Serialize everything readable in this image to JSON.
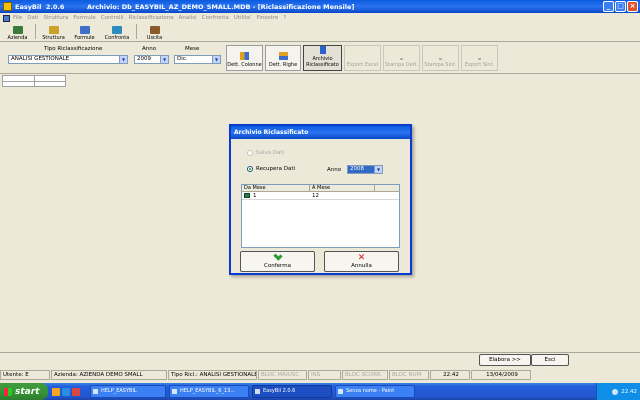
{
  "window": {
    "title": "EasyBil  2.0.6          Archivio: Db_EASYBIL_AZ_DEMO_SMALL.MDB - [Riclassificazione Mensile]"
  },
  "menu": [
    "File",
    "Dati",
    "Struttura",
    "Formule",
    "Controlli",
    "Riclassificazione",
    "Analisi",
    "Confronta",
    "Utilita'",
    "Finestre",
    "?"
  ],
  "toolbar": [
    {
      "label": "Azienda",
      "icon": "building-icon",
      "color": "#3a7a3a"
    },
    {
      "label": "Struttura",
      "icon": "structure-icon",
      "color": "#c9a227"
    },
    {
      "label": "Formule",
      "icon": "formula-icon",
      "color": "#3b6fc9"
    },
    {
      "label": "Confronta",
      "icon": "compare-icon",
      "color": "#2e8bc0"
    },
    {
      "label": "Uscita",
      "icon": "exit-icon",
      "color": "#8a5a2a"
    }
  ],
  "params": {
    "tipo_label": "Tipo Riclassificazione",
    "tipo_value": "ANALISI GESTIONALE",
    "anno_label": "Anno",
    "anno_value": "2009",
    "mese_label": "Mese",
    "mese_value": "Dic."
  },
  "action_buttons": {
    "dett_colonne": "Dett. Colonne",
    "dett_righe": "Dett. Righe",
    "archivio": "Archivio\nRiclassificato",
    "export_excel": "Export Excel",
    "stampa_dett": "Stampa Dett.",
    "stampa_sint": "Stampa Sint.",
    "export_sint": "Export Sint."
  },
  "dialog": {
    "title": "Archivio Riclassificato",
    "salva_label": "Salva Dati",
    "recupera_label": "Recupera Dati",
    "anno_label": "Anno",
    "anno_value": "2008",
    "columns": [
      "Da Mese",
      "A Mese"
    ],
    "rows": [
      [
        "1",
        "12"
      ]
    ],
    "confirm_label": "Conferma",
    "cancel_label": "Annulla"
  },
  "bottom": {
    "elabora_label": "Elabora >>",
    "esci_label": "Esci"
  },
  "status": {
    "utente": "Utente: E",
    "azienda": "Azienda: AZIENDA DEMO SMALL",
    "tipo_ric": "Tipo Ricl.: ANALISI GESTIONALE",
    "bloc_maiusc": "BLOC MAIUSC",
    "ins": "INS",
    "bloc_scorr": "BLOC SCORR",
    "bloc_num": "BLOC NUM",
    "time": "22.42",
    "date": "13/04/2009"
  },
  "taskbar": {
    "start_label": "start",
    "tasks": [
      "HELP_EASYBIL",
      "HELP_EASYBIL_6_13...",
      "EasyBil  2.0.6",
      "Senza nome - Paint"
    ],
    "clock": "22.42"
  },
  "colors": {
    "title_blue": "#0a5be0",
    "face": "#ece9d8",
    "start_green": "#379637"
  }
}
